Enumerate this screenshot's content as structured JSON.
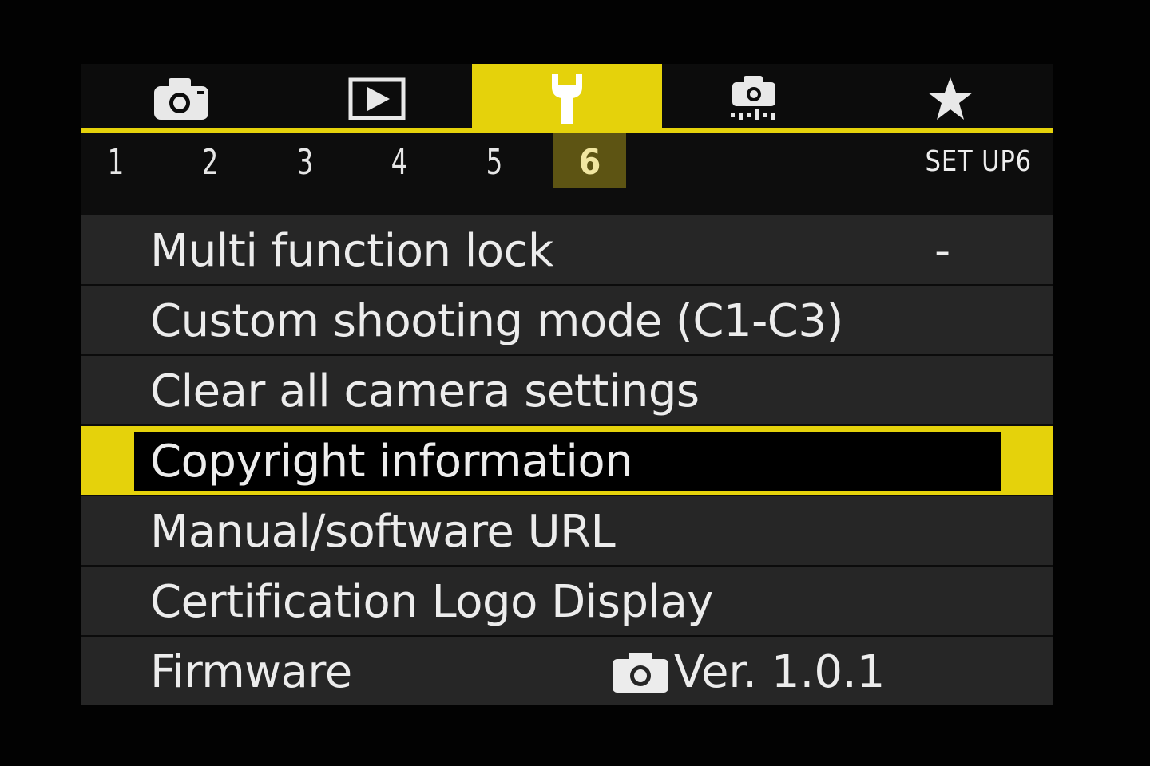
{
  "tabs": [
    {
      "icon": "camera-icon",
      "active": false
    },
    {
      "icon": "playback-icon",
      "active": false
    },
    {
      "icon": "wrench-icon",
      "active": true
    },
    {
      "icon": "custom-function-icon",
      "active": false
    },
    {
      "icon": "star-icon",
      "active": false
    }
  ],
  "subtabs": [
    "1",
    "2",
    "3",
    "4",
    "5",
    "6"
  ],
  "active_subtab": "6",
  "menu_title": "SET UP6",
  "items": [
    {
      "label": "Multi function lock",
      "value": "-"
    },
    {
      "label": "Custom shooting mode (C1-C3)",
      "value": ""
    },
    {
      "label": "Clear all camera settings",
      "value": ""
    },
    {
      "label": "Copyright information",
      "value": "",
      "selected": true
    },
    {
      "label": "Manual/software URL",
      "value": ""
    },
    {
      "label": "Certification Logo Display",
      "value": ""
    },
    {
      "label": "Firmware",
      "value": "Ver. 1.0.1"
    }
  ],
  "colors": {
    "accent": "#e5d20b",
    "row_bg": "#262626",
    "text": "#ececec"
  }
}
